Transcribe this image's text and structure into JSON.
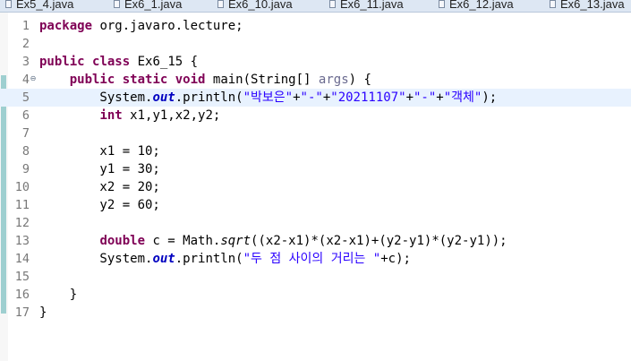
{
  "tabs": [
    {
      "label": "Ex5_4.java"
    },
    {
      "label": "Ex6_1.java"
    },
    {
      "label": "Ex6_10.java"
    },
    {
      "label": "Ex6_11.java"
    },
    {
      "label": "Ex6_12.java"
    },
    {
      "label": "Ex6_13.java"
    }
  ],
  "editor": {
    "current_line": 5,
    "line_numbers": [
      "1",
      "2",
      "3",
      "4",
      "5",
      "6",
      "7",
      "8",
      "9",
      "10",
      "11",
      "12",
      "13",
      "14",
      "15",
      "16",
      "17"
    ],
    "fold_marker": "⊖",
    "code": {
      "l1_kw": "package",
      "l1_rest": " org.javaro.lecture;",
      "l3_kw1": "public",
      "l3_kw2": "class",
      "l3_rest": " Ex6_15 {",
      "l4_indent": "    ",
      "l4_kw1": "public",
      "l4_kw2": "static",
      "l4_kw3": "void",
      "l4_rest1": " main(String[] ",
      "l4_param": "args",
      "l4_rest2": ") {",
      "l5_pre": "        System.",
      "l5_field": "out",
      "l5_mid": ".println(",
      "l5_s1": "\"박보은\"",
      "l5_p1": "+",
      "l5_s2": "\"-\"",
      "l5_p2": "+",
      "l5_s3": "\"20211107\"",
      "l5_p3": "+",
      "l5_s4": "\"-\"",
      "l5_p4": "+",
      "l5_s5": "\"객체\"",
      "l5_end": ");",
      "l6_indent": "        ",
      "l6_kw": "int",
      "l6_rest": " x1,y1,x2,y2;",
      "l8": "        x1 = 10;",
      "l9": "        y1 = 30;",
      "l10": "        x2 = 20;",
      "l11": "        y2 = 60;",
      "l13_indent": "        ",
      "l13_kw": "double",
      "l13_mid": " c = Math.",
      "l13_method": "sqrt",
      "l13_rest": "((x2-x1)*(x2-x1)+(y2-y1)*(y2-y1));",
      "l14_pre": "        System.",
      "l14_field": "out",
      "l14_mid": ".println(",
      "l14_str": "\"두 점 사이의 거리는 \"",
      "l14_end": "+c);",
      "l16": "    }",
      "l17": "}"
    }
  },
  "colors": {
    "keyword": "#7f0055",
    "string": "#2a00ff",
    "field": "#0000c0",
    "current_line": "#e8f2fe",
    "quick_diff": "#9ecfd0"
  }
}
